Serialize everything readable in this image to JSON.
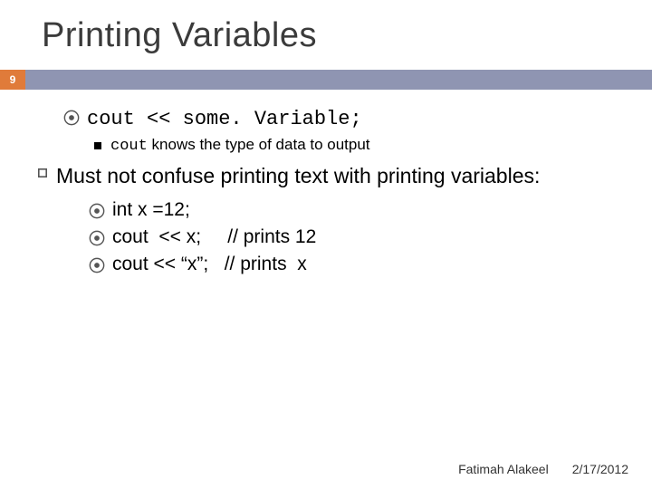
{
  "title": "Printing Variables",
  "page_number": "9",
  "line1_pre": "cout",
  "line1_rest": " << some. Variable;",
  "line2_pre": "cout",
  "line2_rest": " knows the type of data to output",
  "para": "Must not confuse printing text with printing variables:",
  "sub1": "int x =12;",
  "sub2": "cout  << x;     // prints 12",
  "sub3": "cout << “x”;   // prints  x",
  "footer_author": "Fatimah Alakeel",
  "footer_date": "2/17/2012"
}
